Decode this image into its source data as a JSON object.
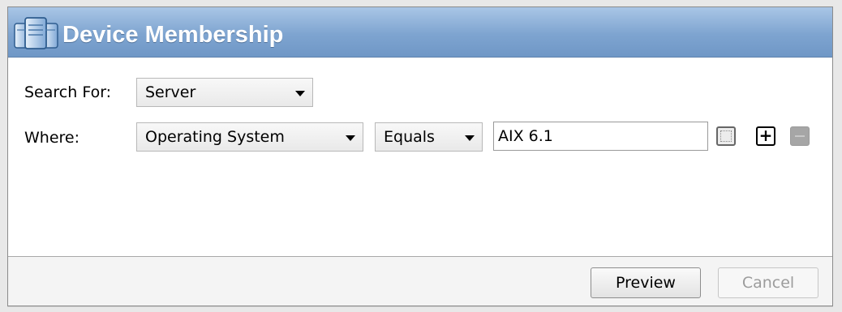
{
  "dialog": {
    "title": "Device Membership",
    "icon": "server-rack-icon"
  },
  "search_for": {
    "label": "Search For:",
    "value": "Server"
  },
  "where": {
    "label": "Where:",
    "attribute": "Operating System",
    "operator": "Equals",
    "value": "AIX 6.1"
  },
  "footer": {
    "preview_label": "Preview",
    "cancel_label": "Cancel"
  },
  "colors": {
    "title_bar": "#7ea4d0",
    "title_text": "#ffffff"
  }
}
